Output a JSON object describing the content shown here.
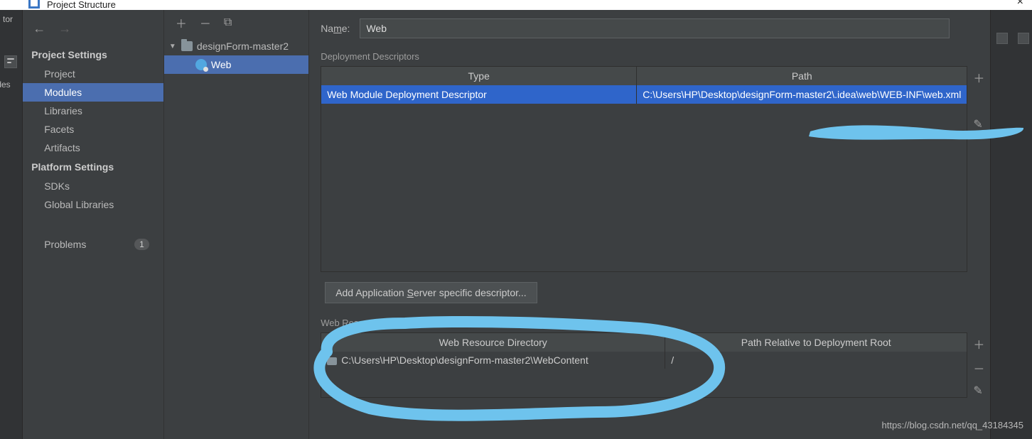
{
  "window": {
    "title": "Project Structure"
  },
  "left_remnant": {
    "top_text": "tor",
    "side_text": "\\des"
  },
  "sidebar": {
    "sections": [
      {
        "heading": "Project Settings",
        "items": [
          {
            "label": "Project",
            "selected": false
          },
          {
            "label": "Modules",
            "selected": true
          },
          {
            "label": "Libraries",
            "selected": false
          },
          {
            "label": "Facets",
            "selected": false
          },
          {
            "label": "Artifacts",
            "selected": false
          }
        ]
      },
      {
        "heading": "Platform Settings",
        "items": [
          {
            "label": "SDKs",
            "selected": false
          },
          {
            "label": "Global Libraries",
            "selected": false
          }
        ]
      }
    ],
    "problems": {
      "label": "Problems",
      "count": "1"
    }
  },
  "tree": {
    "module_name": "designForm-master2",
    "child_name": "Web"
  },
  "content": {
    "name_label_pre": "Na",
    "name_label_u": "m",
    "name_label_post": "e:",
    "name_value": "Web",
    "desc_section": "Deployment Descriptors",
    "desc_headers": {
      "type": "Type",
      "path": "Path"
    },
    "desc_row": {
      "type": "Web Module Deployment Descriptor",
      "path": "C:\\Users\\HP\\Desktop\\designForm-master2\\.idea\\web\\WEB-INF\\web.xml"
    },
    "add_btn_pre": "Add Application ",
    "add_btn_u": "S",
    "add_btn_post": "erver specific descriptor...",
    "webres_section": "Web Resource Directories",
    "webres_headers": {
      "dir": "Web Resource Directory",
      "rel": "Path Relative to Deployment Root"
    },
    "webres_row": {
      "dir": "C:\\Users\\HP\\Desktop\\designForm-master2\\WebContent",
      "rel": "/"
    }
  },
  "watermark": "https://blog.csdn.net/qq_43184345"
}
